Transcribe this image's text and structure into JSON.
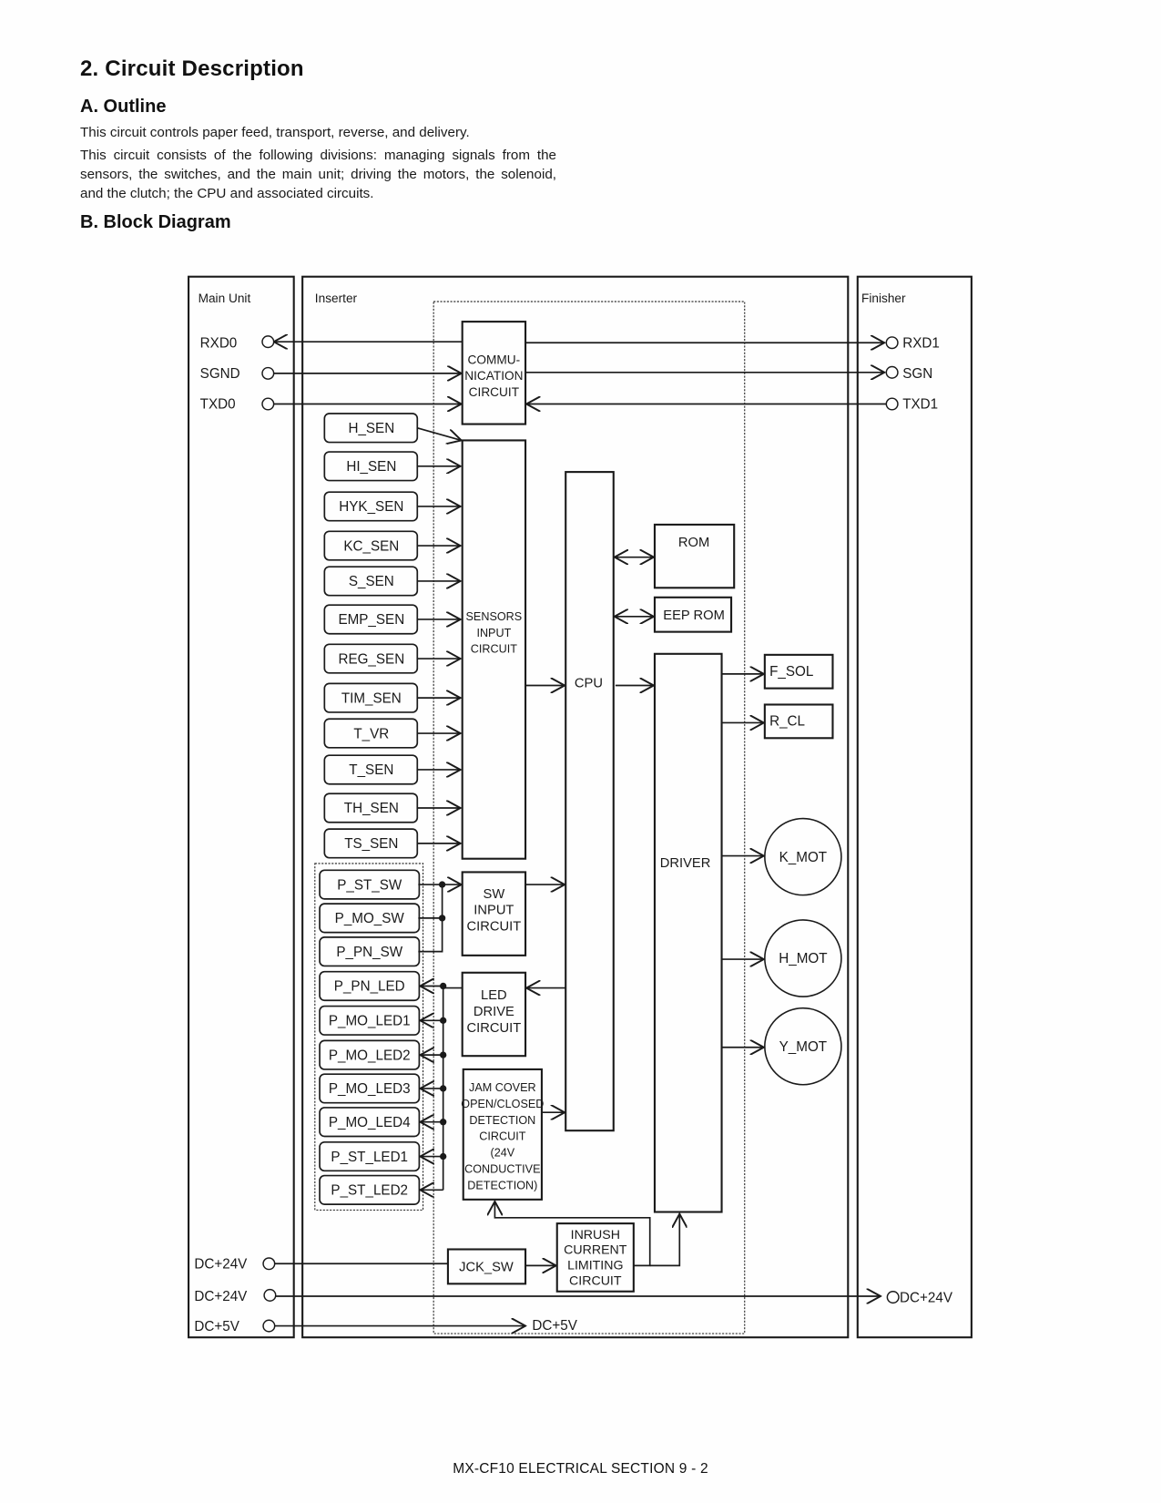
{
  "page": {
    "section_title": "2.  Circuit Description",
    "outline": {
      "heading": "A.  Outline",
      "paragraphs": [
        "This circuit controls paper feed, transport, reverse, and delivery.",
        "This circuit consists of the following divisions: managing signals from the sensors, the switches, and the main unit; driving the motors, the solenoid, and the clutch; the CPU and associated circuits."
      ]
    },
    "block_diagram_heading": "B.  Block Diagram",
    "footer": "MX-CF10  ELECTRICAL SECTION  9 - 2"
  },
  "diagram": {
    "units": {
      "main_unit": "Main Unit",
      "inserter": "Inserter",
      "finisher": "Finisher"
    },
    "main_unit_terminals": {
      "rxd0": "RXD0",
      "sgnd": "SGND",
      "txd0": "TXD0",
      "dc24v_a": "DC+24V",
      "dc24v_b": "DC+24V",
      "dc5v": "DC+5V"
    },
    "finisher_terminals": {
      "rxd1": "RXD1",
      "sgn": "SGN",
      "txd1": "TXD1",
      "dc24v": "DC+24V"
    },
    "blocks": {
      "comm": [
        "COMMU-",
        "NICATION",
        "CIRCUIT"
      ],
      "sensors": [
        "SENSORS",
        "INPUT",
        "CIRCUIT"
      ],
      "sw_input": [
        "SW",
        "INPUT",
        "CIRCUIT"
      ],
      "led_drive": [
        "LED",
        "DRIVE",
        "CIRCUIT"
      ],
      "jam_cover": [
        "JAM COVER",
        "OPEN/CLOSED",
        "DETECTION",
        "CIRCUIT",
        "(24V",
        "CONDUCTIVE",
        "DETECTION)"
      ],
      "cpu": "CPU",
      "rom": "ROM",
      "eeprom": "EEP ROM",
      "driver": "DRIVER",
      "jck_sw": "JCK_SW",
      "inrush": [
        "INRUSH",
        "CURRENT",
        "LIMITING",
        "CIRCUIT"
      ],
      "dc5v_label": "DC+5V"
    },
    "sensors": [
      "H_SEN",
      "HI_SEN",
      "HYK_SEN",
      "KC_SEN",
      "S_SEN",
      "EMP_SEN",
      "REG_SEN",
      "TIM_SEN",
      "T_VR",
      "T_SEN",
      "TH_SEN",
      "TS_SEN"
    ],
    "switches": [
      "P_ST_SW",
      "P_MO_SW",
      "P_PN_SW"
    ],
    "leds": [
      "P_PN_LED",
      "P_MO_LED1",
      "P_MO_LED2",
      "P_MO_LED3",
      "P_MO_LED4",
      "P_ST_LED1",
      "P_ST_LED2"
    ],
    "loads": {
      "f_sol": "F_SOL",
      "r_cl": "R_CL"
    },
    "motors": [
      "K_MOT",
      "H_MOT",
      "Y_MOT"
    ]
  }
}
